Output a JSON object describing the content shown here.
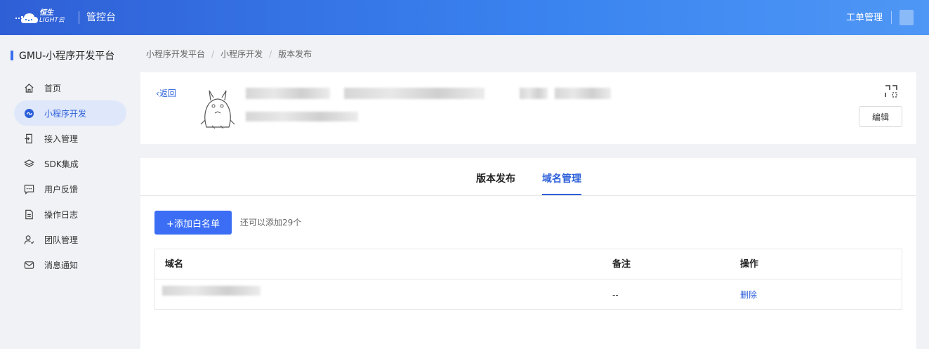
{
  "topbar": {
    "logo_line1": "恒生",
    "logo_line2": "LIGHT云",
    "console": "管控台",
    "ticket": "工单管理"
  },
  "sidebar": {
    "title": "GMU-小程序开发平台",
    "items": [
      {
        "label": "首页",
        "icon": "home-icon"
      },
      {
        "label": "小程序开发",
        "icon": "miniapp-icon",
        "active": true
      },
      {
        "label": "接入管理",
        "icon": "access-icon"
      },
      {
        "label": "SDK集成",
        "icon": "layers-icon"
      },
      {
        "label": "用户反馈",
        "icon": "feedback-icon"
      },
      {
        "label": "操作日志",
        "icon": "document-icon"
      },
      {
        "label": "团队管理",
        "icon": "team-icon"
      },
      {
        "label": "消息通知",
        "icon": "mail-icon"
      }
    ]
  },
  "breadcrumb": [
    "小程序开发平台",
    "小程序开发",
    "版本发布"
  ],
  "header": {
    "back": "返回",
    "edit": "编辑"
  },
  "tabs": [
    {
      "label": "版本发布",
      "active": false
    },
    {
      "label": "域名管理",
      "active": true
    }
  ],
  "whitelist": {
    "add_button": "+添加白名单",
    "hint": "还可以添加29个"
  },
  "table": {
    "columns": [
      "域名",
      "备注",
      "操作"
    ],
    "rows": [
      {
        "remark": "--",
        "action": "删除"
      }
    ]
  },
  "colors": {
    "primary": "#3b6ef5",
    "link": "#2c5fd9",
    "active_bg": "#dfe8fb"
  }
}
